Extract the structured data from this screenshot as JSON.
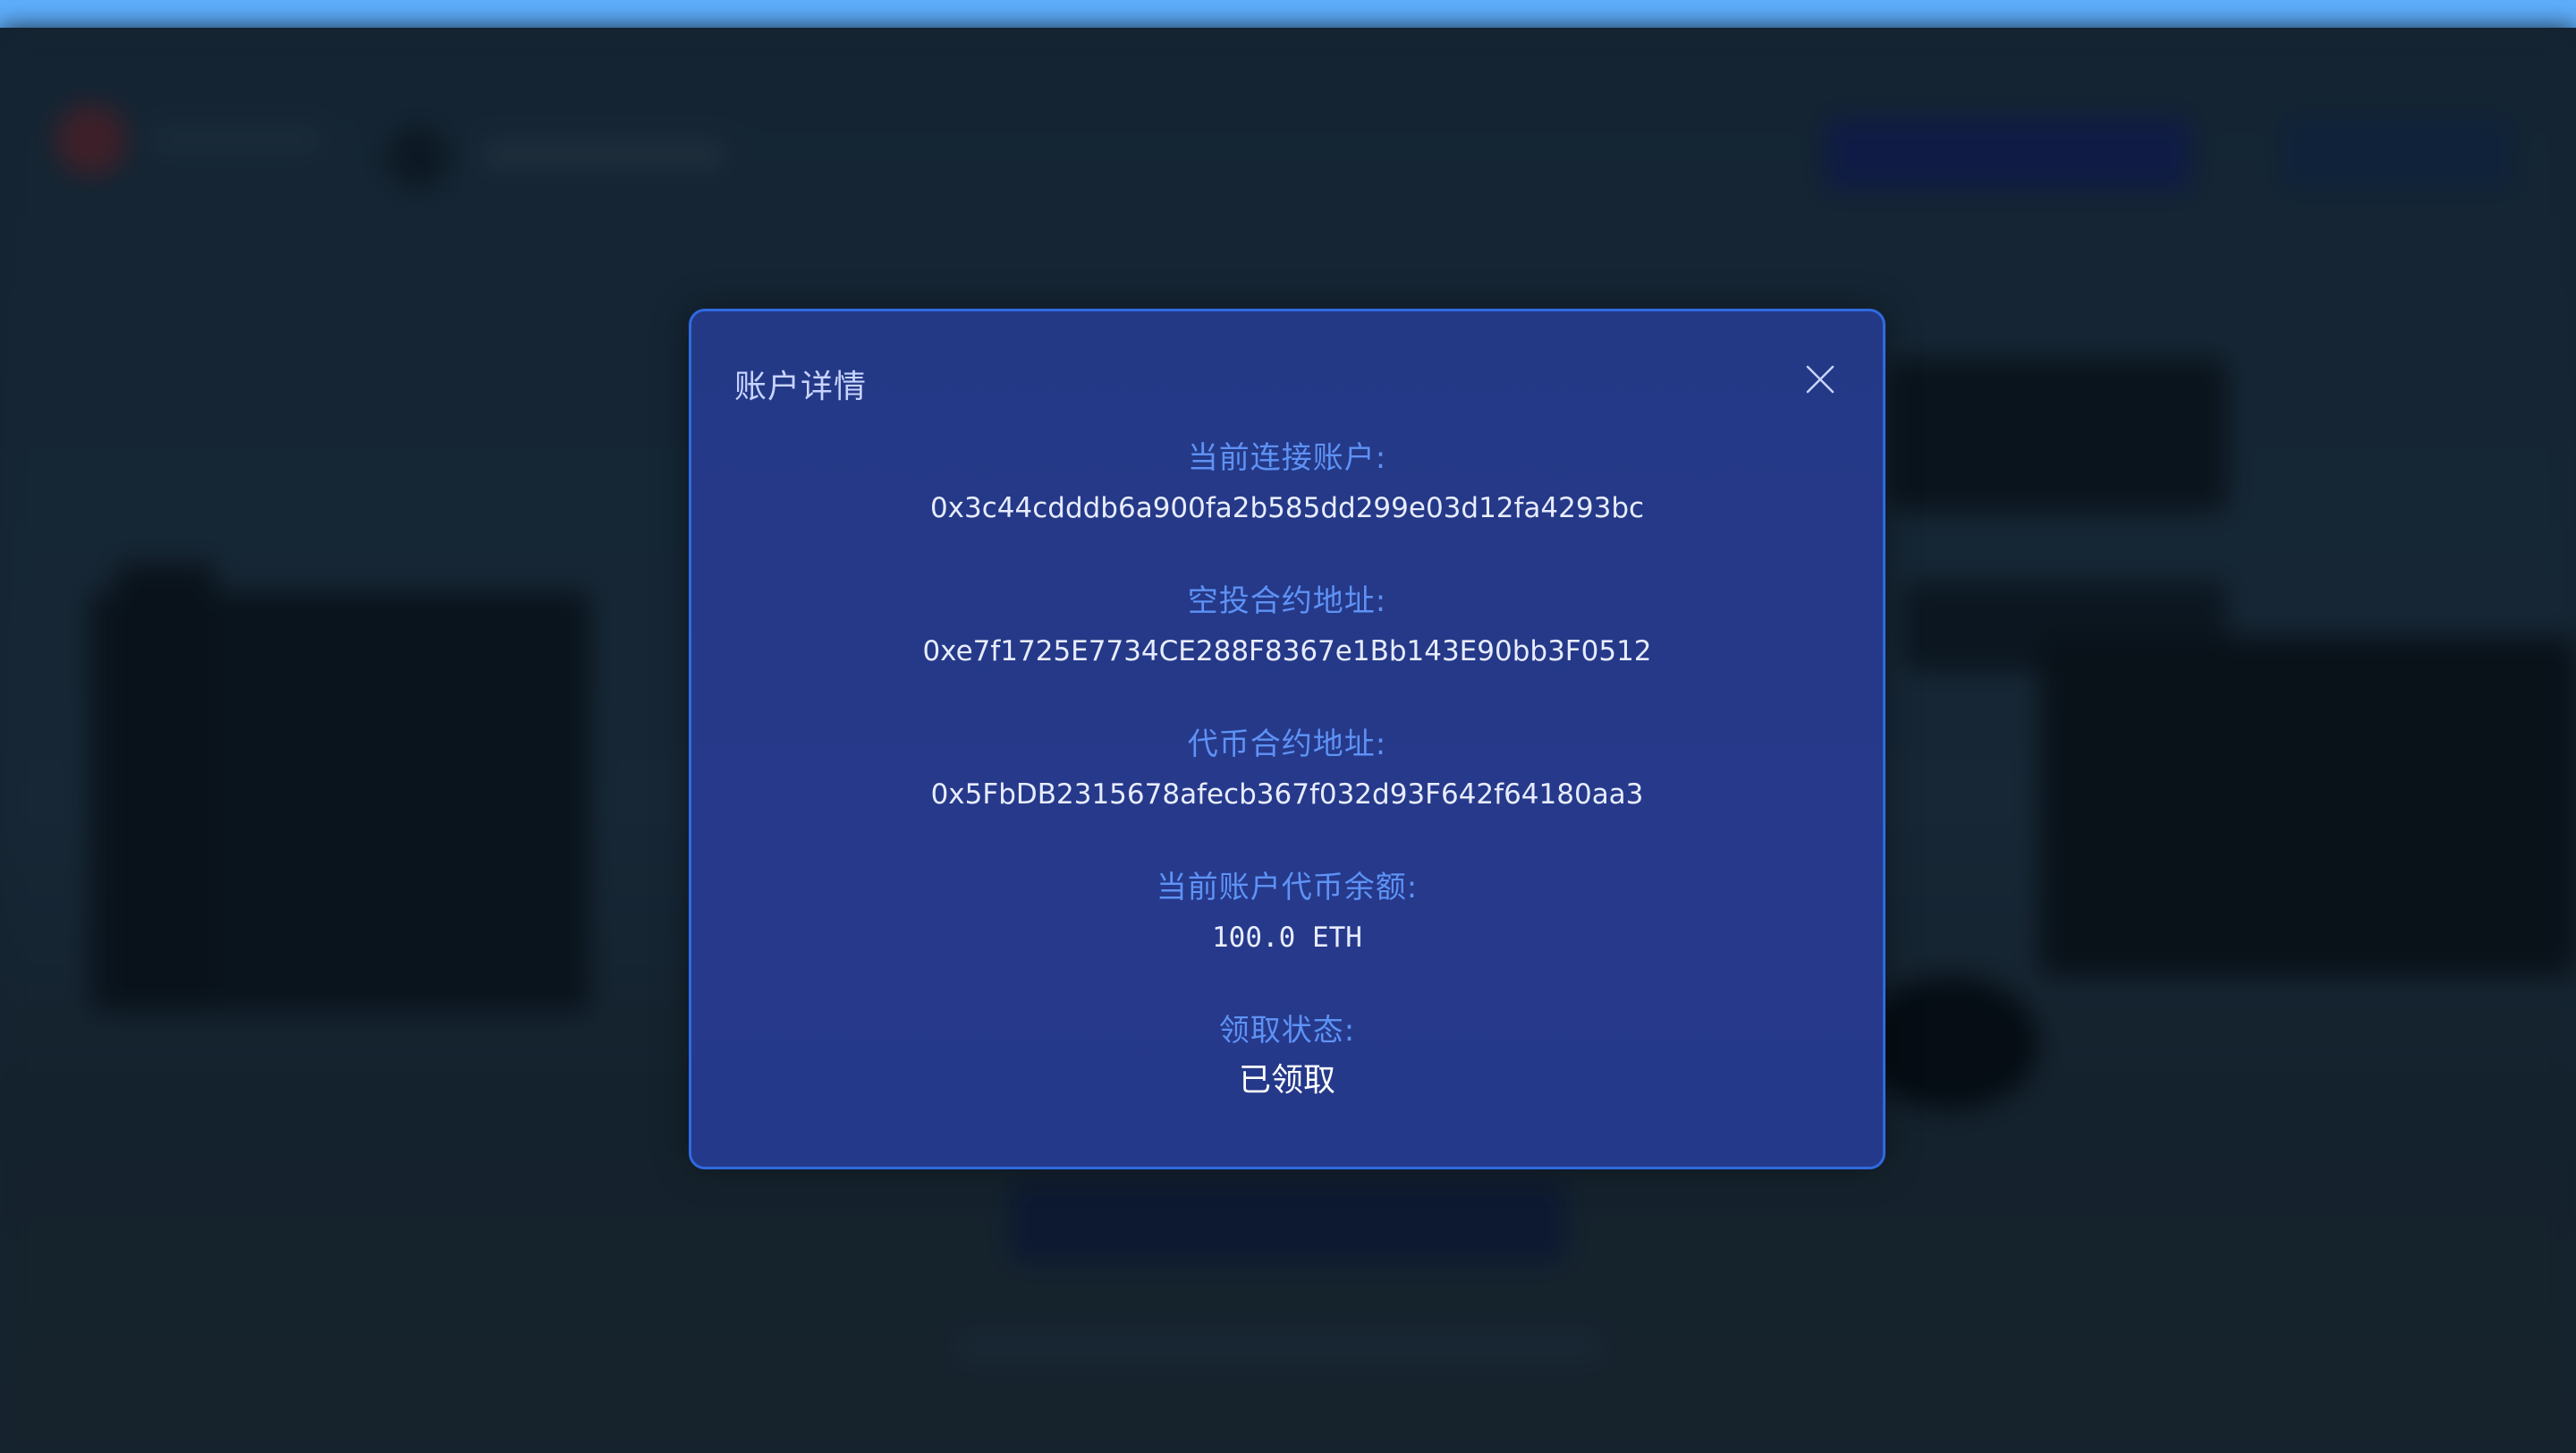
{
  "modal": {
    "title": "账户详情",
    "close_icon": "close-icon",
    "fields": [
      {
        "label": "当前连接账户:",
        "value": "0x3c44cdddb6a900fa2b585dd299e03d12fa4293bc"
      },
      {
        "label": "空投合约地址:",
        "value": "0xe7f1725E7734CE288F8367e1Bb143E90bb3F0512"
      },
      {
        "label": "代币合约地址:",
        "value": "0x5FbDB2315678afecb367f032d93F642f64180aa3"
      },
      {
        "label": "当前账户代币余额:",
        "value": "100.0 ETH"
      },
      {
        "label": "领取状态:",
        "value": "已领取"
      }
    ]
  },
  "colors": {
    "top_strip": "#5eaefc",
    "modal_bg": "#25398a",
    "modal_border": "#2f6ae0",
    "label_color": "#5e92f5",
    "value_color": "#e7ecff"
  }
}
